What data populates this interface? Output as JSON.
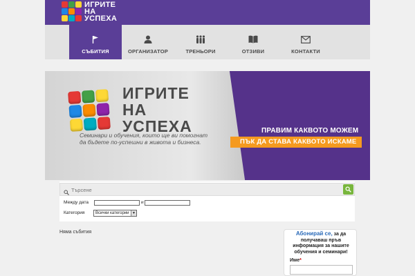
{
  "header": {
    "logo_lines": [
      "ИГРИТЕ",
      "НА",
      "УСПЕХА"
    ],
    "cube_colors": [
      "#e53935",
      "#43a047",
      "#fdd835",
      "#1e88e5",
      "#fb8c00",
      "#8e24aa",
      "#fdd835",
      "#00acc1",
      "#e53935"
    ],
    "accent": "#5a3e97"
  },
  "nav": {
    "items": [
      {
        "label": "СЪБИТИЯ",
        "icon": "flag-icon",
        "active": true
      },
      {
        "label": "ОРГАНИЗАТОР",
        "icon": "person-icon",
        "active": false
      },
      {
        "label": "ТРЕНЬОРИ",
        "icon": "people-icon",
        "active": false
      },
      {
        "label": "ОТЗИВИ",
        "icon": "book-icon",
        "active": false
      },
      {
        "label": "КОНТАКТИ",
        "icon": "envelope-icon",
        "active": false
      }
    ]
  },
  "banner": {
    "title_lines": [
      "ИГРИТЕ",
      "НА",
      "УСПЕХА"
    ],
    "subtitle_lines": [
      "Семинари и обучения, които ще ви помогнат",
      "да бъдете по-успешни в живота и бизнеса."
    ],
    "slogan_line1": "ПРАВИМ КАКВОТО МОЖЕМ",
    "slogan_line2": "ПЪК ДА СТАВА КАКВОТО ИСКАМЕ",
    "slogan_color": "#f59a1f"
  },
  "search": {
    "placeholder": "Търсене",
    "value": "",
    "date_label": "Между дата",
    "date_joiner": "и",
    "date_from": "",
    "date_to": "",
    "category_label": "Категория",
    "category_selected": "Всички категории"
  },
  "events": {
    "empty_text": "Няма събития"
  },
  "subscribe": {
    "link_text": "Абонирай се,",
    "text": "за да получаваш пръв информация за нашите обучения и семинари!",
    "name_label": "Име",
    "required_mark": "*",
    "name_value": ""
  }
}
